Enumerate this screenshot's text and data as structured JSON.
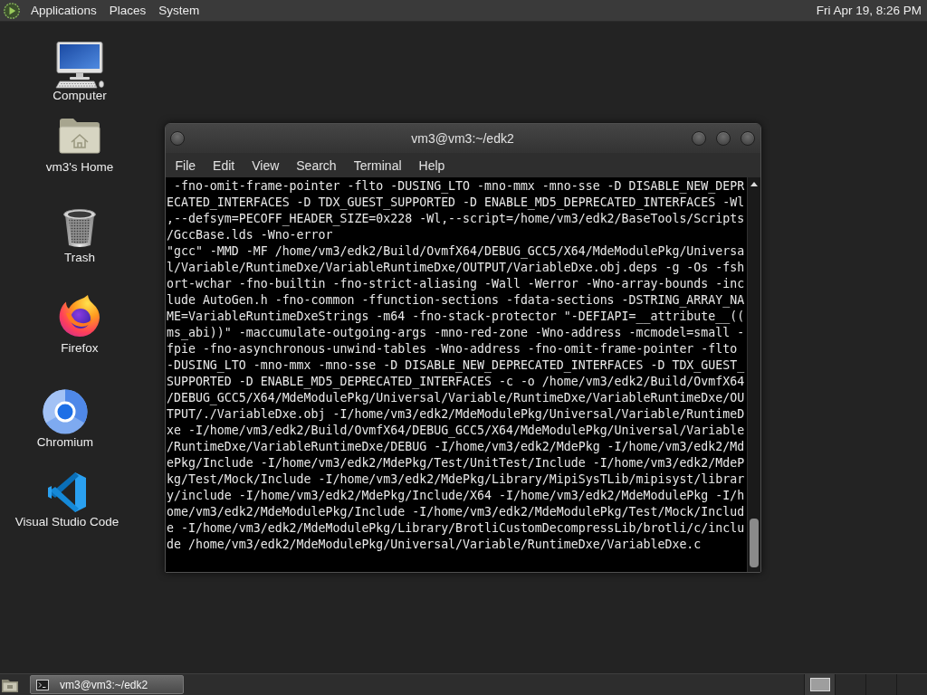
{
  "top_panel": {
    "menus": [
      "Applications",
      "Places",
      "System"
    ],
    "clock": "Fri Apr 19, 8:26 PM"
  },
  "desktop_icons": [
    {
      "label": "Computer",
      "kind": "computer"
    },
    {
      "label": "vm3's Home",
      "kind": "home"
    },
    {
      "label": "Trash",
      "kind": "trash"
    },
    {
      "label": "Firefox",
      "kind": "firefox"
    },
    {
      "label": "Chromium",
      "kind": "chromium"
    },
    {
      "label": "Visual Studio Code",
      "kind": "vscode"
    }
  ],
  "terminal_window": {
    "title": "vm3@vm3:~/edk2",
    "menu": [
      "File",
      "Edit",
      "View",
      "Search",
      "Terminal",
      "Help"
    ],
    "lines": [
      " -fno-omit-frame-pointer -flto -DUSING_LTO -mno-mmx -mno-sse -D DISABLE_NEW_DEPR",
      "ECATED_INTERFACES -D TDX_GUEST_SUPPORTED -D ENABLE_MD5_DEPRECATED_INTERFACES -Wl",
      ",--defsym=PECOFF_HEADER_SIZE=0x228 -Wl,--script=/home/vm3/edk2/BaseTools/Scripts",
      "/GccBase.lds -Wno-error",
      "\"gcc\" -MMD -MF /home/vm3/edk2/Build/OvmfX64/DEBUG_GCC5/X64/MdeModulePkg/Universa",
      "l/Variable/RuntimeDxe/VariableRuntimeDxe/OUTPUT/VariableDxe.obj.deps -g -Os -fsh",
      "ort-wchar -fno-builtin -fno-strict-aliasing -Wall -Werror -Wno-array-bounds -inc",
      "lude AutoGen.h -fno-common -ffunction-sections -fdata-sections -DSTRING_ARRAY_NA",
      "ME=VariableRuntimeDxeStrings -m64 -fno-stack-protector \"-DEFIAPI=__attribute__((",
      "ms_abi))\" -maccumulate-outgoing-args -mno-red-zone -Wno-address -mcmodel=small -",
      "fpie -fno-asynchronous-unwind-tables -Wno-address -fno-omit-frame-pointer -flto",
      "-DUSING_LTO -mno-mmx -mno-sse -D DISABLE_NEW_DEPRECATED_INTERFACES -D TDX_GUEST_",
      "SUPPORTED -D ENABLE_MD5_DEPRECATED_INTERFACES -c -o /home/vm3/edk2/Build/OvmfX64",
      "/DEBUG_GCC5/X64/MdeModulePkg/Universal/Variable/RuntimeDxe/VariableRuntimeDxe/OU",
      "TPUT/./VariableDxe.obj -I/home/vm3/edk2/MdeModulePkg/Universal/Variable/RuntimeD",
      "xe -I/home/vm3/edk2/Build/OvmfX64/DEBUG_GCC5/X64/MdeModulePkg/Universal/Variable",
      "/RuntimeDxe/VariableRuntimeDxe/DEBUG -I/home/vm3/edk2/MdePkg -I/home/vm3/edk2/Md",
      "ePkg/Include -I/home/vm3/edk2/MdePkg/Test/UnitTest/Include -I/home/vm3/edk2/MdeP",
      "kg/Test/Mock/Include -I/home/vm3/edk2/MdePkg/Library/MipiSysTLib/mipisyst/librar",
      "y/include -I/home/vm3/edk2/MdePkg/Include/X64 -I/home/vm3/edk2/MdeModulePkg -I/h",
      "ome/vm3/edk2/MdeModulePkg/Include -I/home/vm3/edk2/MdeModulePkg/Test/Mock/Includ",
      "e -I/home/vm3/edk2/MdeModulePkg/Library/BrotliCustomDecompressLib/brotli/c/inclu",
      "de /home/vm3/edk2/MdeModulePkg/Universal/Variable/RuntimeDxe/VariableDxe.c"
    ]
  },
  "bottom_panel": {
    "tasks": [
      {
        "label": "vm3@vm3:~/edk2",
        "selected": true
      }
    ],
    "workspaces": [
      {
        "selected": true
      },
      {
        "selected": false
      },
      {
        "selected": false
      },
      {
        "selected": false
      }
    ]
  }
}
